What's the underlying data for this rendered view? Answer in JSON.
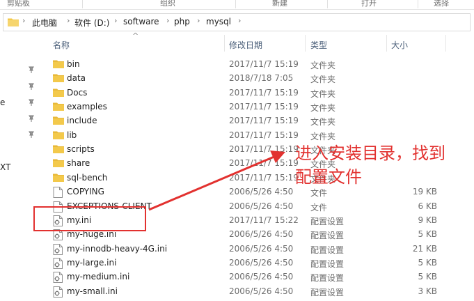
{
  "ribbon": {
    "groups": [
      "剪贴板",
      "组织",
      "新建",
      "打开",
      "选择"
    ]
  },
  "address": {
    "crumbs": [
      "此电脑",
      "软件 (D:)",
      "software",
      "php",
      "mysql"
    ]
  },
  "nav_pane": {
    "fragments": [
      "e",
      "XT"
    ]
  },
  "columns": {
    "name": "名称",
    "date": "修改日期",
    "type": "类型",
    "size": "大小"
  },
  "files": [
    {
      "name": "bin",
      "date": "2017/11/7 15:19",
      "type": "文件夹",
      "size": "",
      "icon": "folder-icon"
    },
    {
      "name": "data",
      "date": "2018/7/18 7:05",
      "type": "文件夹",
      "size": "",
      "icon": "folder-icon"
    },
    {
      "name": "Docs",
      "date": "2017/11/7 15:19",
      "type": "文件夹",
      "size": "",
      "icon": "folder-icon"
    },
    {
      "name": "examples",
      "date": "2017/11/7 15:19",
      "type": "文件夹",
      "size": "",
      "icon": "folder-icon"
    },
    {
      "name": "include",
      "date": "2017/11/7 15:19",
      "type": "文件夹",
      "size": "",
      "icon": "folder-icon"
    },
    {
      "name": "lib",
      "date": "2017/11/7 15:19",
      "type": "文件夹",
      "size": "",
      "icon": "folder-icon"
    },
    {
      "name": "scripts",
      "date": "2017/11/7 15:19",
      "type": "文件夹",
      "size": "",
      "icon": "folder-icon"
    },
    {
      "name": "share",
      "date": "2017/11/7 15:19",
      "type": "文件夹",
      "size": "",
      "icon": "folder-icon"
    },
    {
      "name": "sql-bench",
      "date": "2017/11/7 15:19",
      "type": "文件夹",
      "size": "",
      "icon": "folder-icon"
    },
    {
      "name": "COPYING",
      "date": "2006/5/26 4:50",
      "type": "文件",
      "size": "19 KB",
      "icon": "file-icon"
    },
    {
      "name": "EXCEPTIONS-CLIENT",
      "date": "2006/5/26 4:50",
      "type": "文件",
      "size": "6 KB",
      "icon": "file-icon"
    },
    {
      "name": "my.ini",
      "date": "2017/11/7 15:22",
      "type": "配置设置",
      "size": "9 KB",
      "icon": "config-file-icon"
    },
    {
      "name": "my-huge.ini",
      "date": "2006/5/26 4:50",
      "type": "配置设置",
      "size": "5 KB",
      "icon": "config-file-icon"
    },
    {
      "name": "my-innodb-heavy-4G.ini",
      "date": "2006/5/26 4:50",
      "type": "配置设置",
      "size": "21 KB",
      "icon": "config-file-icon"
    },
    {
      "name": "my-large.ini",
      "date": "2006/5/26 4:50",
      "type": "配置设置",
      "size": "5 KB",
      "icon": "config-file-icon"
    },
    {
      "name": "my-medium.ini",
      "date": "2006/5/26 4:50",
      "type": "配置设置",
      "size": "5 KB",
      "icon": "config-file-icon"
    },
    {
      "name": "my-small.ini",
      "date": "2006/5/26 4:50",
      "type": "配置设置",
      "size": "3 KB",
      "icon": "config-file-icon"
    }
  ],
  "annotation": {
    "line1": "进入安装目录，找到",
    "line2": "配置文件",
    "color": "#e2312f"
  },
  "colors": {
    "folder": "#f3c94b",
    "header_text": "#4c607a"
  }
}
